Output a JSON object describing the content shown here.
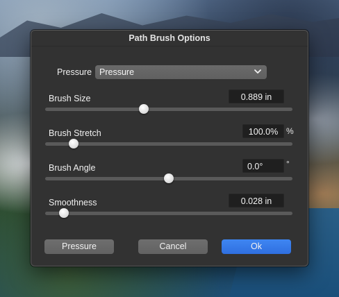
{
  "dialog": {
    "title": "Path Brush Options"
  },
  "pressure_select": {
    "label": "Pressure",
    "value": "Pressure"
  },
  "sliders": [
    {
      "label": "Brush Size",
      "value": "0.889 in",
      "unit": "",
      "level": 0.4
    },
    {
      "label": "Brush Stretch",
      "value": "100.0%",
      "unit": "%",
      "level": 0.115
    },
    {
      "label": "Brush Angle",
      "value": "0.0°",
      "unit": "°",
      "level": 0.5
    },
    {
      "label": "Smoothness",
      "value": "0.028 in",
      "unit": "",
      "level": 0.075
    }
  ],
  "buttons": {
    "pressure": "Pressure",
    "cancel": "Cancel",
    "ok": "Ok"
  },
  "colors": {
    "accent": "#3a7ff0",
    "dialog_bg": "#323232"
  }
}
